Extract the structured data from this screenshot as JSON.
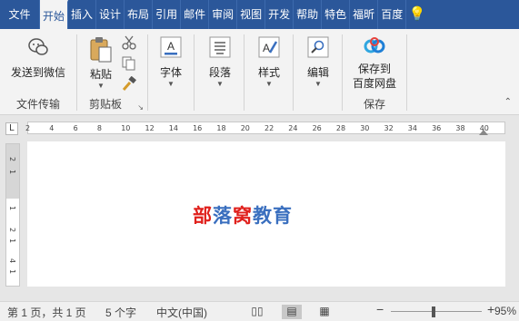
{
  "tabs": [
    {
      "label": "文件",
      "name": "tab-file"
    },
    {
      "label": "开始",
      "name": "tab-home",
      "active": true
    },
    {
      "label": "插入",
      "name": "tab-insert"
    },
    {
      "label": "设计",
      "name": "tab-design"
    },
    {
      "label": "布局",
      "name": "tab-layout"
    },
    {
      "label": "引用",
      "name": "tab-references"
    },
    {
      "label": "邮件",
      "name": "tab-mailings"
    },
    {
      "label": "审阅",
      "name": "tab-review"
    },
    {
      "label": "视图",
      "name": "tab-view"
    },
    {
      "label": "开发",
      "name": "tab-developer"
    },
    {
      "label": "帮助",
      "name": "tab-help"
    },
    {
      "label": "特色",
      "name": "tab-featured"
    },
    {
      "label": "福昕",
      "name": "tab-foxit"
    },
    {
      "label": "百度",
      "name": "tab-baidu"
    }
  ],
  "ribbon": {
    "send_wechat": "发送到微信",
    "group_transfer": "文件传输",
    "paste": "粘贴",
    "group_clipboard": "剪贴板",
    "font": "字体",
    "paragraph": "段落",
    "styles": "样式",
    "editing": "编辑",
    "save_to_line1": "保存到",
    "save_to_line2": "百度网盘",
    "group_save": "保存"
  },
  "ruler": {
    "corner": "L",
    "ticks": [
      "2",
      "4",
      "6",
      "8",
      "10",
      "12",
      "14",
      "16",
      "18",
      "20",
      "22",
      "24",
      "26",
      "28",
      "30",
      "32",
      "34",
      "36",
      "38",
      "40"
    ],
    "vticks": [
      "2",
      "1",
      "1",
      "2",
      "1",
      "4",
      "1"
    ]
  },
  "document": {
    "chars": [
      {
        "t": "部",
        "color": "#e0201c"
      },
      {
        "t": "落",
        "color": "#3a6fbf"
      },
      {
        "t": "窝",
        "color": "#e0201c"
      },
      {
        "t": "教",
        "color": "#3a6fbf"
      },
      {
        "t": "育",
        "color": "#3a6fbf"
      }
    ]
  },
  "status": {
    "page": "第 1 页，共 1 页",
    "words": "5 个字",
    "language": "中文(中国)",
    "zoom_minus": "−",
    "zoom_plus": "+",
    "zoom_level": "95%",
    "zoom_fraction": 0.47
  }
}
